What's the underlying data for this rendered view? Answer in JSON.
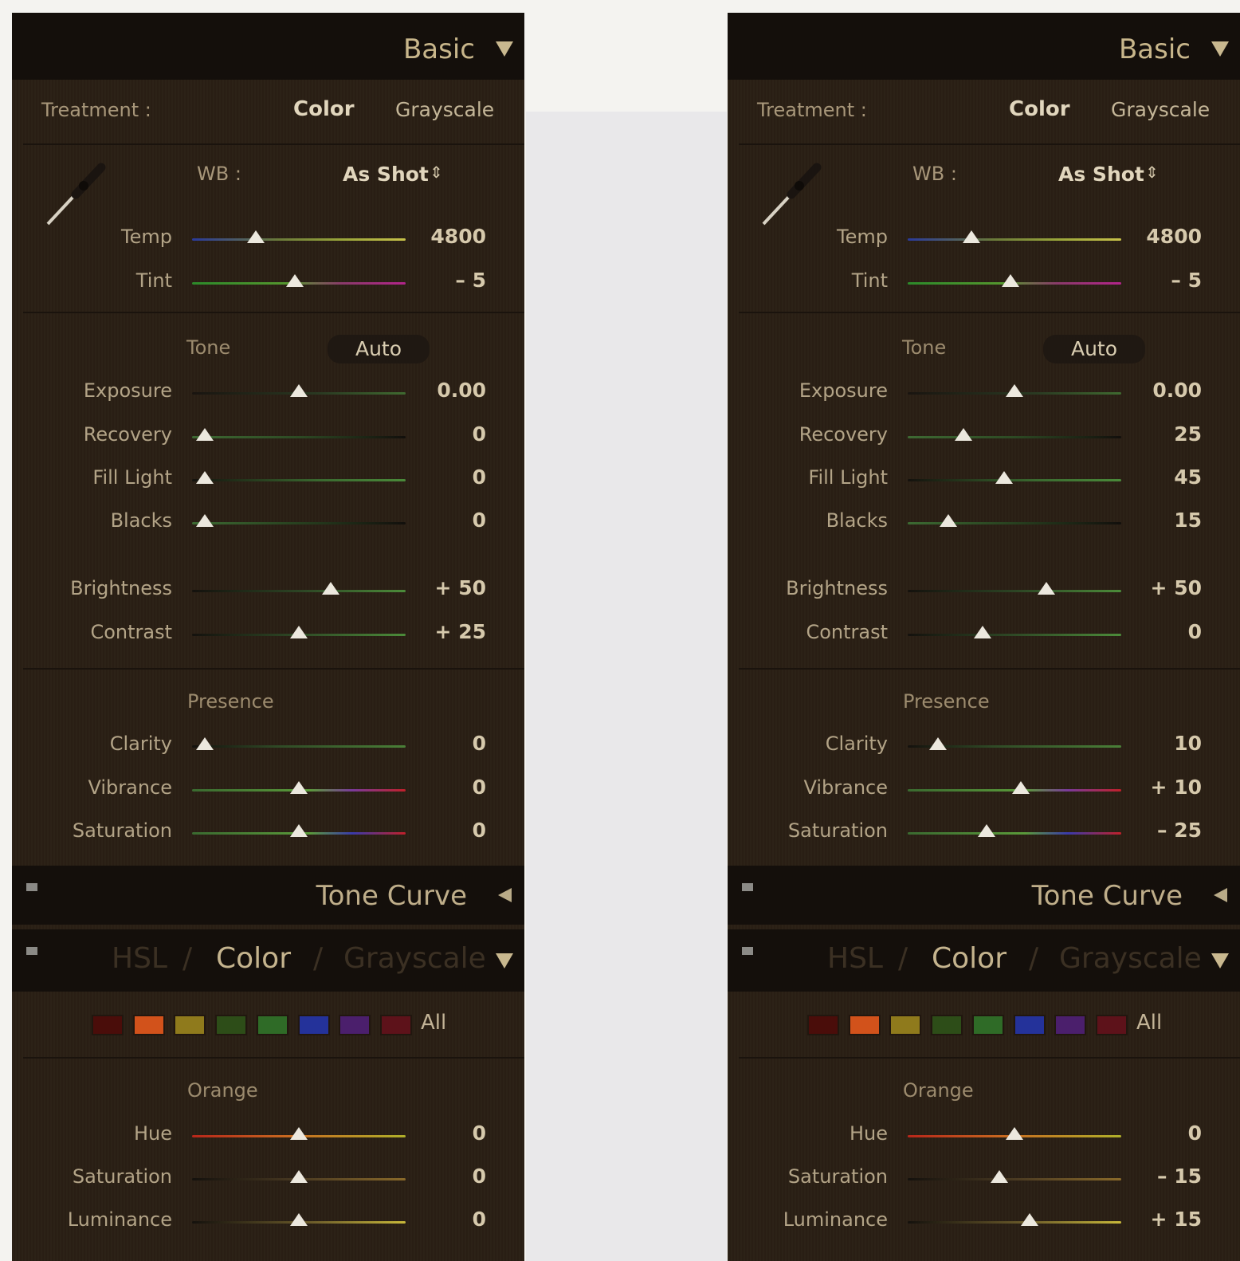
{
  "panels": [
    {
      "basic_title": "Basic",
      "treatment_label": "Treatment :",
      "treatment_color": "Color",
      "treatment_grayscale": "Grayscale",
      "wb_label": "WB :",
      "wb_value": "As Shot",
      "wb_arrows": "⇕",
      "tone_label": "Tone",
      "auto_label": "Auto",
      "presence_label": "Presence",
      "tone_curve_title": "Tone Curve",
      "hsl_tabs": [
        "HSL",
        "/",
        "Color",
        "/",
        "Grayscale"
      ],
      "swatches_all": "All",
      "orange_label": "Orange",
      "sliders": {
        "temp": {
          "label": "Temp",
          "value": "4800",
          "pos": 0.3
        },
        "tint": {
          "label": "Tint",
          "value": "– 5",
          "pos": 0.48
        },
        "exposure": {
          "label": "Exposure",
          "value": "0.00",
          "pos": 0.5
        },
        "recovery": {
          "label": "Recovery",
          "value": "0",
          "pos": 0.06
        },
        "fill_light": {
          "label": "Fill Light",
          "value": "0",
          "pos": 0.06
        },
        "blacks": {
          "label": "Blacks",
          "value": "0",
          "pos": 0.06
        },
        "brightness": {
          "label": "Brightness",
          "value": "+ 50",
          "pos": 0.65
        },
        "contrast": {
          "label": "Contrast",
          "value": "+ 25",
          "pos": 0.5
        },
        "clarity": {
          "label": "Clarity",
          "value": "0",
          "pos": 0.06
        },
        "vibrance": {
          "label": "Vibrance",
          "value": "0",
          "pos": 0.5
        },
        "saturation": {
          "label": "Saturation",
          "value": "0",
          "pos": 0.5
        },
        "hue_o": {
          "label": "Hue",
          "value": "0",
          "pos": 0.5
        },
        "sat_o": {
          "label": "Saturation",
          "value": "0",
          "pos": 0.5
        },
        "lum_o": {
          "label": "Luminance",
          "value": "0",
          "pos": 0.5
        }
      }
    },
    {
      "basic_title": "Basic",
      "treatment_label": "Treatment :",
      "treatment_color": "Color",
      "treatment_grayscale": "Grayscale",
      "wb_label": "WB :",
      "wb_value": "As Shot",
      "wb_arrows": "⇕",
      "tone_label": "Tone",
      "auto_label": "Auto",
      "presence_label": "Presence",
      "tone_curve_title": "Tone Curve",
      "hsl_tabs": [
        "HSL",
        "/",
        "Color",
        "/",
        "Grayscale"
      ],
      "swatches_all": "All",
      "orange_label": "Orange",
      "sliders": {
        "temp": {
          "label": "Temp",
          "value": "4800",
          "pos": 0.3
        },
        "tint": {
          "label": "Tint",
          "value": "– 5",
          "pos": 0.48
        },
        "exposure": {
          "label": "Exposure",
          "value": "0.00",
          "pos": 0.5
        },
        "recovery": {
          "label": "Recovery",
          "value": "25",
          "pos": 0.26
        },
        "fill_light": {
          "label": "Fill Light",
          "value": "45",
          "pos": 0.45
        },
        "blacks": {
          "label": "Blacks",
          "value": "15",
          "pos": 0.19
        },
        "brightness": {
          "label": "Brightness",
          "value": "+ 50",
          "pos": 0.65
        },
        "contrast": {
          "label": "Contrast",
          "value": "0",
          "pos": 0.35
        },
        "clarity": {
          "label": "Clarity",
          "value": "10",
          "pos": 0.14
        },
        "vibrance": {
          "label": "Vibrance",
          "value": "+ 10",
          "pos": 0.53
        },
        "saturation": {
          "label": "Saturation",
          "value": "– 25",
          "pos": 0.37
        },
        "hue_o": {
          "label": "Hue",
          "value": "0",
          "pos": 0.5
        },
        "sat_o": {
          "label": "Saturation",
          "value": "– 15",
          "pos": 0.43
        },
        "lum_o": {
          "label": "Luminance",
          "value": "+ 15",
          "pos": 0.57
        }
      }
    }
  ],
  "colors": {
    "panel_bg": "#2a1f14",
    "header_bg": "#140f0b",
    "title": "#c8b68b",
    "thumb": "#ece8de"
  },
  "swatch_colors": [
    "#4a0d0a",
    "#d2521b",
    "#8f7a1c",
    "#2d4d18",
    "#2f6b27",
    "#24329a",
    "#4b1f6c",
    "#5d121a"
  ]
}
